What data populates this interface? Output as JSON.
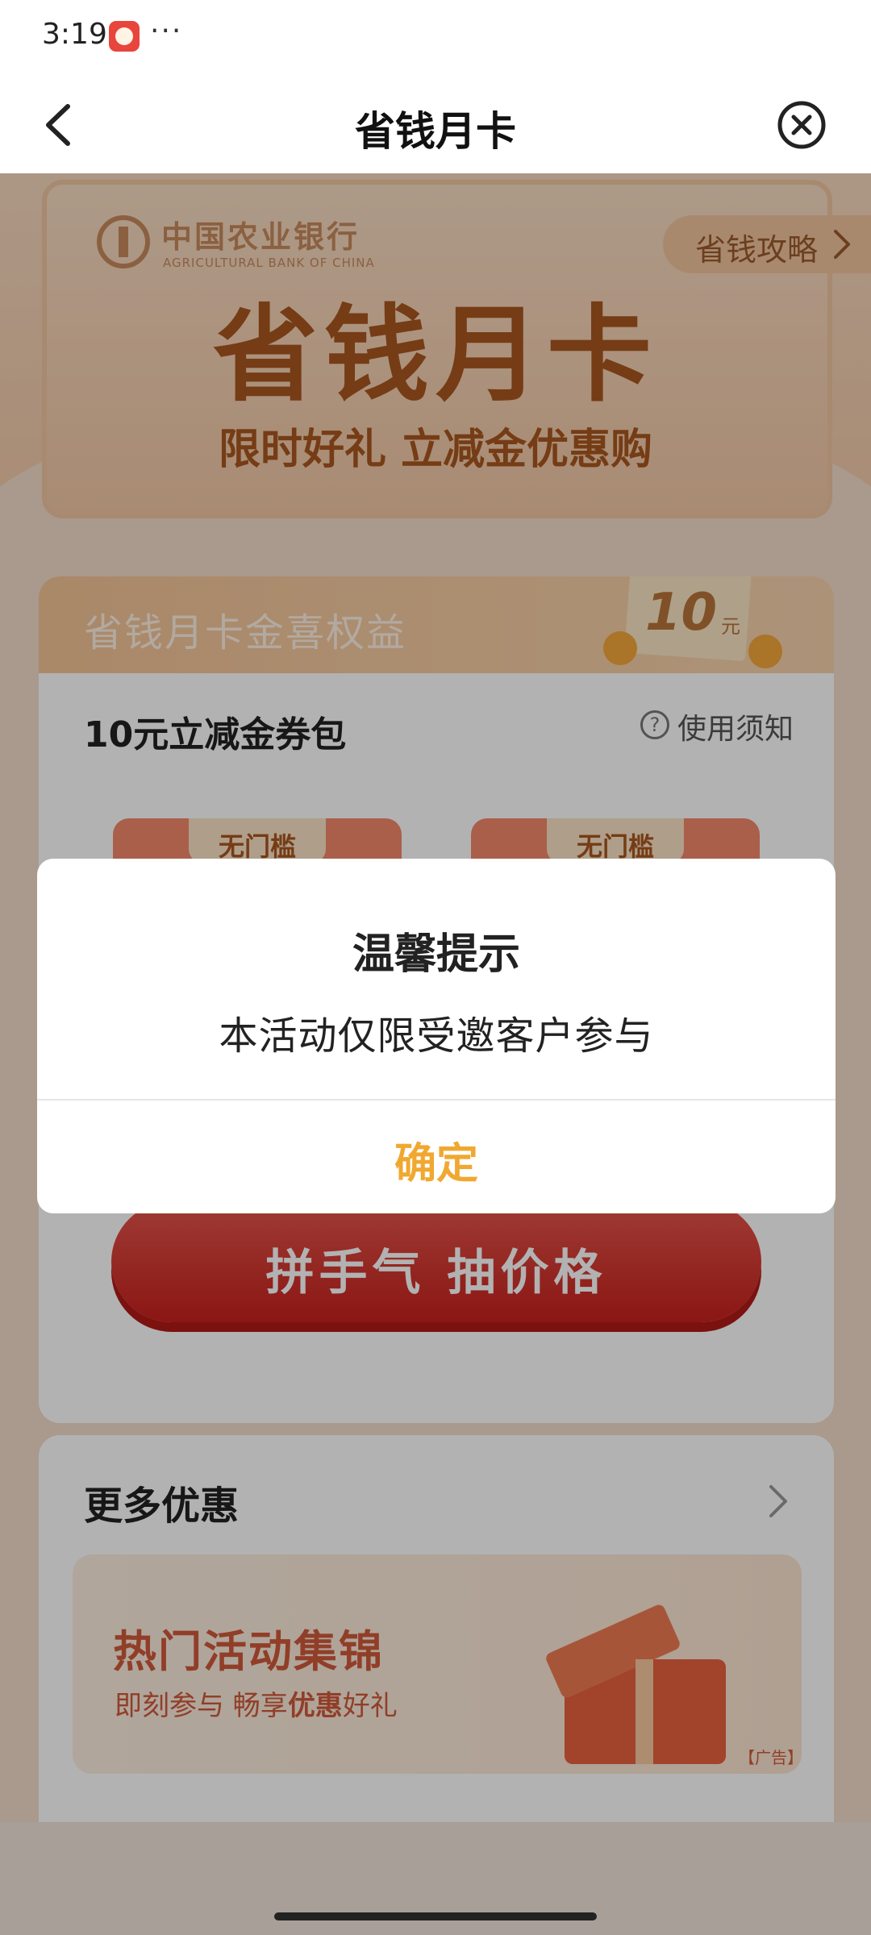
{
  "status_bar": {
    "time": "3:19",
    "more": "···"
  },
  "nav": {
    "title": "省钱月卡",
    "back_icon": "chevron-left-icon",
    "close_icon": "close-circle-icon"
  },
  "hero": {
    "bank_name_cn": "中国农业银行",
    "bank_name_en": "AGRICULTURAL BANK OF CHINA",
    "strategy_label": "省钱攻略",
    "title": "省钱月卡",
    "subtitle": "限时好礼 立减金优惠购"
  },
  "benefit": {
    "header_title": "省钱月卡金喜权益",
    "ticket_amount": "10",
    "ticket_unit": "元",
    "coupon_pack_title": "10元立减金券包",
    "usage_label": "使用须知",
    "coupons": [
      {
        "tag": "无门槛"
      },
      {
        "tag": "无门槛"
      }
    ],
    "lottery_label": "拼手气 抽价格"
  },
  "more": {
    "title": "更多优惠",
    "promo_title": "热门活动集锦",
    "promo_subtitle_a": "即刻参与  畅享",
    "promo_subtitle_b": "优惠",
    "promo_subtitle_c": "好礼",
    "ad_label": "【广告】"
  },
  "dialog": {
    "title": "温馨提示",
    "message": "本活动仅限受邀客户参与",
    "confirm_label": "确定"
  },
  "colors": {
    "accent": "#f0a830",
    "brand": "#a8561f",
    "lottery": "#c8201c"
  }
}
